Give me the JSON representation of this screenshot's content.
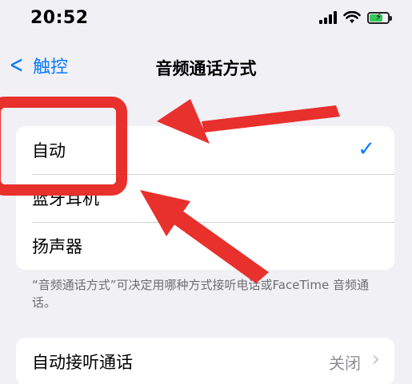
{
  "status_bar": {
    "time": "20:52",
    "icons": [
      "signal-icon",
      "wifi-icon",
      "battery-charging-icon"
    ]
  },
  "nav": {
    "back_label": "触控",
    "title": "音频通话方式"
  },
  "options": {
    "items": [
      {
        "label": "自动",
        "selected": true
      },
      {
        "label": "蓝牙耳机",
        "selected": false
      },
      {
        "label": "扬声器",
        "selected": false
      }
    ],
    "check_glyph": "✓"
  },
  "footnote": "“音频通话方式”可决定用哪种方式接听电话或FaceTime 音频通话。",
  "auto_answer": {
    "label": "自动接听通话",
    "value": "关闭"
  },
  "colors": {
    "accent": "#0a7aff",
    "annotation": "#e8302c",
    "background": "#f0f0f5"
  }
}
